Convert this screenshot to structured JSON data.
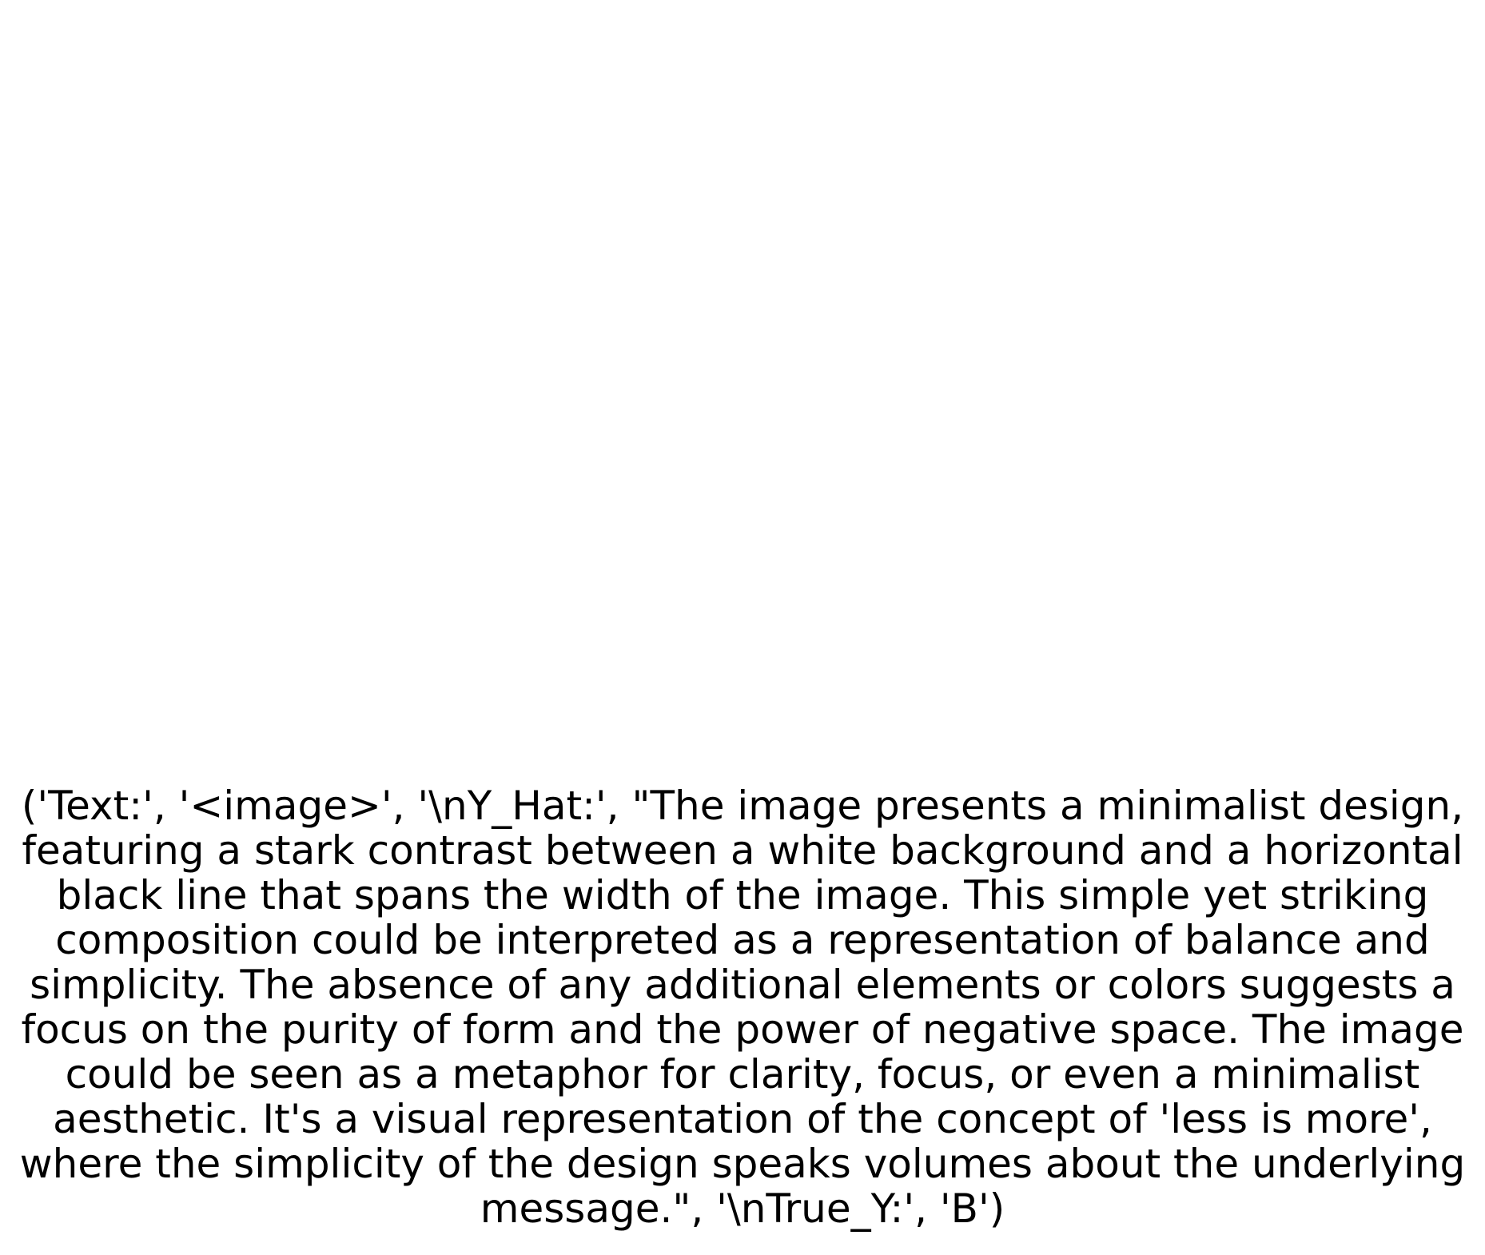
{
  "caption": {
    "lines": [
      "('Text:', '<image>', '\\nY_Hat:', \"The image presents a minimalist design,",
      "featuring a stark contrast between a white background and a horizontal",
      "black line that spans the width of the image. This simple yet striking",
      "composition could be interpreted as a representation of balance and",
      "simplicity. The absence of any additional elements or colors suggests a",
      "focus on the purity of form and the power of negative space. The image",
      "could be seen as a metaphor for clarity, focus, or even a minimalist",
      "aesthetic. It's a visual representation of the concept of 'less is more',",
      "where the simplicity of the design speaks volumes about the underlying",
      "message.\", '\\nTrue_Y:', 'B')"
    ]
  },
  "colors": {
    "background": "#ffffff",
    "text": "#000000"
  }
}
